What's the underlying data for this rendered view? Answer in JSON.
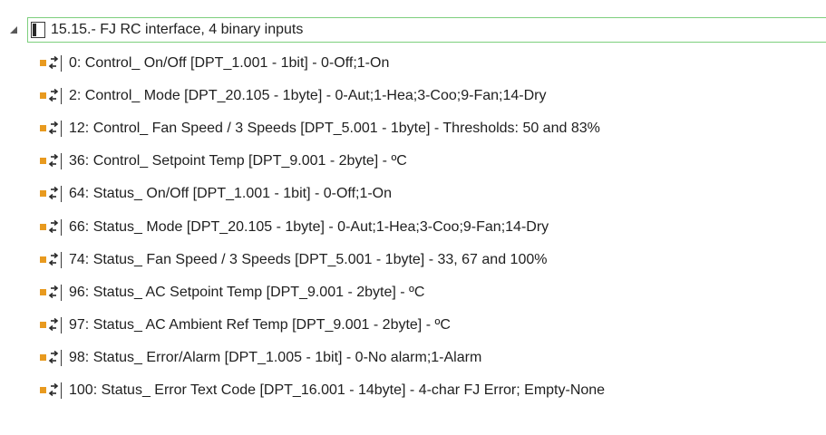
{
  "tree": {
    "parent": {
      "label": "15.15.- FJ RC interface, 4 binary inputs",
      "expanded": true
    },
    "children": [
      {
        "label": "0: Control_ On/Off [DPT_1.001 - 1bit] - 0-Off;1-On"
      },
      {
        "label": "2: Control_ Mode [DPT_20.105 - 1byte] - 0-Aut;1-Hea;3-Coo;9-Fan;14-Dry"
      },
      {
        "label": "12: Control_ Fan Speed / 3 Speeds [DPT_5.001 - 1byte] - Thresholds: 50 and 83%"
      },
      {
        "label": "36: Control_ Setpoint Temp [DPT_9.001 - 2byte] - ºC"
      },
      {
        "label": "64: Status_ On/Off [DPT_1.001 - 1bit] - 0-Off;1-On"
      },
      {
        "label": "66: Status_ Mode [DPT_20.105 - 1byte] - 0-Aut;1-Hea;3-Coo;9-Fan;14-Dry"
      },
      {
        "label": "74: Status_ Fan Speed / 3 Speeds [DPT_5.001 - 1byte] - 33, 67 and 100%"
      },
      {
        "label": "96: Status_ AC Setpoint Temp [DPT_9.001 - 2byte] - ºC"
      },
      {
        "label": "97: Status_ AC Ambient Ref Temp [DPT_9.001 - 2byte] - ºC"
      },
      {
        "label": "98: Status_ Error/Alarm [DPT_1.005 - 1bit] - 0-No alarm;1-Alarm"
      },
      {
        "label": "100: Status_ Error Text Code [DPT_16.001 - 14byte] - 4-char FJ Error; Empty-None"
      }
    ]
  },
  "colors": {
    "selection_border": "#7dcf7d",
    "object_icon": "#e89a1f",
    "text": "#1f1f1f"
  },
  "icons": {
    "expander": "expand-triangle-icon",
    "device": "knx-device-icon",
    "object": "communication-object-icon"
  }
}
